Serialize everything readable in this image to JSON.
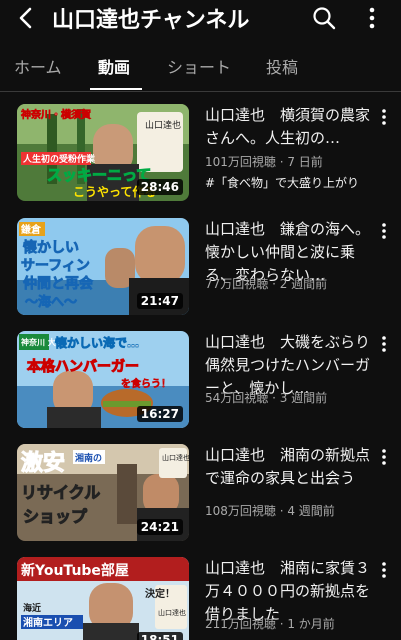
{
  "header": {
    "back_icon": "arrow-left-icon",
    "channel_title": "山口達也チャンネル",
    "search_icon": "search-icon",
    "menu_icon": "more-vert-icon"
  },
  "tabs": [
    {
      "label": "ホーム",
      "active": false
    },
    {
      "label": "動画",
      "active": true
    },
    {
      "label": "ショート",
      "active": false
    },
    {
      "label": "投稿",
      "active": false
    }
  ],
  "videos": [
    {
      "title": "山口達也　横須賀の農家さんへ。人生初の…",
      "meta": "101万回視聴 · 7 日前",
      "badge": "#「食べ物」で大盛り上がり",
      "duration": "28:46",
      "thumb_texts": [
        "神奈川・横須賀",
        "人生初の受粉作業",
        "スッキーニって",
        "こうやって作る",
        "山口達也"
      ]
    },
    {
      "title": "山口達也　鎌倉の海へ。懐かしい仲間と波に乗る、変わらない…",
      "meta": "77万回視聴 · 2 週間前",
      "duration": "21:47",
      "thumb_texts": [
        "鎌倉",
        "懐かしい",
        "サーフィン",
        "仲間と再会",
        "～海へ～"
      ]
    },
    {
      "title": "山口達也　大磯をぶらり　偶然見つけたハンバーガーと、懐かし…",
      "meta": "54万回視聴 · 3 週間前",
      "duration": "16:27",
      "thumb_texts": [
        "神奈川 大磯",
        "懐かしい海で…",
        "本格ハンバーガー",
        "を食らう！"
      ]
    },
    {
      "title": "山口達也　湘南の新拠点で運命の家具と出会う",
      "meta": "108万回視聴 · 4 週間前",
      "duration": "24:21",
      "thumb_texts": [
        "激安",
        "湘南の",
        "リサイクル",
        "ショップ",
        "山口達也"
      ]
    },
    {
      "title": "山口達也　湘南に家賃３万４０００円の新拠点を借りました",
      "meta": "211万回視聴 · 1 か月前",
      "duration": "18:51",
      "thumb_texts": [
        "新YouTube部屋",
        "決定！",
        "海近",
        "湘南エリア",
        "山口達也"
      ]
    }
  ]
}
